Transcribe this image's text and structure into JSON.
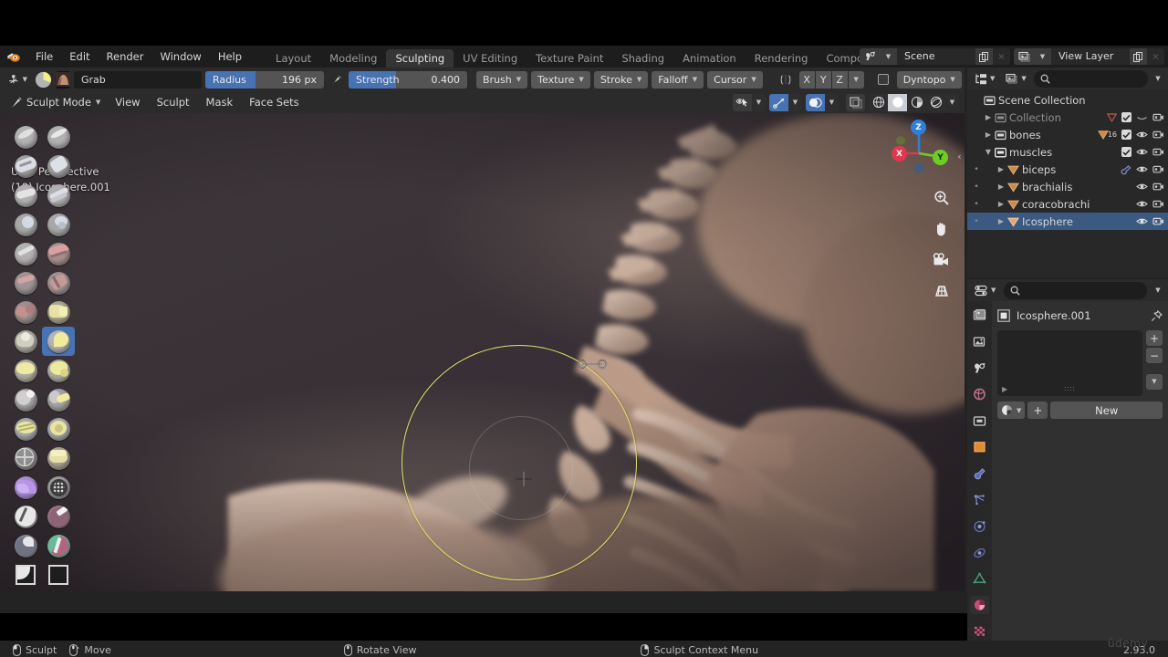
{
  "app": {
    "name": "Blender",
    "version": "2.93.0",
    "watermark": "ûdemy"
  },
  "topbar": {
    "logo_icon": "blender-logo-icon",
    "menus": [
      "File",
      "Edit",
      "Render",
      "Window",
      "Help"
    ],
    "workspaces": [
      {
        "label": "Layout",
        "active": false
      },
      {
        "label": "Modeling",
        "active": false
      },
      {
        "label": "Sculpting",
        "active": true
      },
      {
        "label": "UV Editing",
        "active": false
      },
      {
        "label": "Texture Paint",
        "active": false
      },
      {
        "label": "Shading",
        "active": false
      },
      {
        "label": "Animation",
        "active": false
      },
      {
        "label": "Rendering",
        "active": false
      },
      {
        "label": "Compos",
        "active": false
      }
    ],
    "scene": {
      "icon": "scene-icon",
      "name": "Scene",
      "new_icon": "duplicate-icon",
      "close_icon": "×"
    },
    "view_layer": {
      "icon": "view-layer-icon",
      "name": "View Layer",
      "new_icon": "duplicate-icon",
      "close_icon": "×"
    }
  },
  "tool_settings": {
    "tool_selector_icon": "sculpt-tool-icon",
    "brush_preview_icon": "brush-falloff-icon",
    "brush_texture_icon": "brush-thumbnail-icon",
    "brush_name": "Grab",
    "radius": {
      "label": "Radius",
      "value": "196 px",
      "fill_percent": 42
    },
    "radius_pressure_icon": "pressure-icon",
    "strength": {
      "label": "Strength",
      "value": "0.400",
      "fill_percent": 40
    },
    "popovers": [
      "Brush",
      "Texture",
      "Stroke",
      "Falloff",
      "Cursor"
    ],
    "symmetry_icon": "symmetry-icon",
    "symmetry_axes": [
      "X",
      "Y",
      "Z"
    ],
    "dyntopo_checkbox": false,
    "dyntopo_label": "Dyntopo"
  },
  "viewport_header": {
    "mode": "Sculpt Mode",
    "mode_icon": "sculpt-mode-icon",
    "menus": [
      "View",
      "Sculpt",
      "Mask",
      "Face Sets"
    ],
    "overlay_toggles": [
      {
        "name": "show-gizmo-icon",
        "on": false
      },
      {
        "name": "gizmo-icon",
        "on": true
      },
      {
        "name": "overlays-icon",
        "on": true
      }
    ],
    "xray_icon": "x-ray-icon",
    "shading_modes": [
      {
        "name": "wireframe-shading",
        "on": false
      },
      {
        "name": "solid-shading",
        "on": true
      },
      {
        "name": "material-preview-shading",
        "on": false
      },
      {
        "name": "rendered-shading",
        "on": false
      }
    ]
  },
  "viewport": {
    "info_line1": "User Perspective",
    "info_line2": "(18) Icosphere.001",
    "brush_cursor_color": "#e5e06a",
    "gizmo": {
      "axes": [
        {
          "label": "Z",
          "color": "#2f7fd8"
        },
        {
          "label": "X",
          "color": "#e0384e"
        },
        {
          "label": "Y",
          "color": "#6fcc22"
        }
      ]
    },
    "side_buttons": [
      {
        "name": "zoom-icon"
      },
      {
        "name": "pan-hand-icon"
      },
      {
        "name": "camera-view-icon"
      },
      {
        "name": "toggle-perspective-icon"
      }
    ],
    "sidebar_expand_icon": "chevron-left-icon"
  },
  "brush_toolbar": {
    "tools": [
      {
        "name": "draw-brush",
        "selected": false
      },
      {
        "name": "draw-sharp-brush",
        "selected": false
      },
      {
        "name": "clay-brush",
        "selected": false
      },
      {
        "name": "clay-strips-brush",
        "selected": false
      },
      {
        "name": "clay-thumb-brush",
        "selected": false
      },
      {
        "name": "layer-brush",
        "selected": false
      },
      {
        "name": "inflate-brush",
        "selected": false
      },
      {
        "name": "blob-brush",
        "selected": false
      },
      {
        "name": "crease-brush",
        "selected": false
      },
      {
        "name": "smooth-brush",
        "selected": false
      },
      {
        "name": "flatten-brush",
        "selected": false
      },
      {
        "name": "fill-brush",
        "selected": false
      },
      {
        "name": "scrape-brush",
        "selected": false
      },
      {
        "name": "multiplane-scrape-brush",
        "selected": false
      },
      {
        "name": "pinch-brush",
        "selected": false
      },
      {
        "name": "grab-brush",
        "selected": true
      },
      {
        "name": "elastic-deform-brush",
        "selected": false
      },
      {
        "name": "snake-hook-brush",
        "selected": false
      },
      {
        "name": "thumb-brush",
        "selected": false
      },
      {
        "name": "pose-brush",
        "selected": false
      },
      {
        "name": "nudge-brush",
        "selected": false
      },
      {
        "name": "rotate-brush",
        "selected": false
      },
      {
        "name": "slide-relax-brush",
        "selected": false
      },
      {
        "name": "boundary-brush",
        "selected": false
      },
      {
        "name": "cloth-brush",
        "selected": false
      },
      {
        "name": "simplify-brush",
        "selected": false
      },
      {
        "name": "mask-brush",
        "selected": false
      },
      {
        "name": "draw-face-sets-brush",
        "selected": false
      },
      {
        "name": "multires-displacement-eraser",
        "selected": false
      },
      {
        "name": "paint-brush",
        "selected": false
      },
      {
        "name": "box-mask-tool",
        "selected": false
      },
      {
        "name": "box-hide-tool",
        "selected": false
      }
    ]
  },
  "outliner": {
    "display_mode_icon": "outliner-filter-icon",
    "filter_icon": "filter-icon",
    "search_icon": "search-icon",
    "search_placeholder": "",
    "rows": [
      {
        "indent": 0,
        "disclosure": "",
        "icon": "collection-icon",
        "label": "Scene Collection",
        "dim": false,
        "checkbox": false,
        "eye": false,
        "camera": false,
        "selected": false
      },
      {
        "indent": 1,
        "disclosure": "right",
        "icon": "collection-icon",
        "label": "Collection",
        "dim": true,
        "checkbox": true,
        "eye": "closed",
        "camera": true,
        "badge": "",
        "selected": false,
        "mesh_icon": true
      },
      {
        "indent": 1,
        "disclosure": "right",
        "icon": "collection-icon",
        "label": "bones",
        "dim": false,
        "checkbox": true,
        "eye": "open",
        "camera": true,
        "badge": "16",
        "selected": false,
        "mesh_icon": true
      },
      {
        "indent": 1,
        "disclosure": "down",
        "icon": "collection-icon",
        "label": "muscles",
        "dim": false,
        "checkbox": true,
        "eye": "open",
        "camera": true,
        "selected": false
      },
      {
        "indent": 2,
        "disclosure": "right",
        "icon": "mesh-data-icon",
        "label": "biceps",
        "dim": false,
        "eye": "open",
        "camera": true,
        "extra_icon": "modifier-icon",
        "selected": false
      },
      {
        "indent": 2,
        "disclosure": "right",
        "icon": "mesh-data-icon",
        "label": "brachialis",
        "dim": false,
        "eye": "open",
        "camera": true,
        "selected": false
      },
      {
        "indent": 2,
        "disclosure": "right",
        "icon": "mesh-data-icon",
        "label": "coracobrachi",
        "dim": false,
        "eye": "open",
        "camera": true,
        "selected": false
      },
      {
        "indent": 2,
        "disclosure": "right",
        "icon": "mesh-data-icon",
        "label": "Icosphere",
        "dim": false,
        "eye": "open",
        "camera": true,
        "selected": true
      }
    ]
  },
  "properties": {
    "editor_type_icon": "properties-editor-icon",
    "object_icon": "object-icon",
    "search_icon": "search-icon",
    "search_placeholder": "",
    "options_chevron": "chevron-down-icon",
    "tabs": [
      {
        "name": "render-properties-tab",
        "active": false
      },
      {
        "name": "output-properties-tab",
        "active": false
      },
      {
        "name": "view-layer-properties-tab",
        "active": false
      },
      {
        "name": "scene-properties-tab",
        "active": false
      },
      {
        "name": "world-properties-tab",
        "active": false
      },
      {
        "name": "collection-properties-tab",
        "active": false
      },
      {
        "name": "object-properties-tab",
        "active": false
      },
      {
        "name": "modifier-properties-tab",
        "active": false
      },
      {
        "name": "particle-properties-tab",
        "active": false
      },
      {
        "name": "physics-properties-tab",
        "active": false
      },
      {
        "name": "constraint-properties-tab",
        "active": false
      },
      {
        "name": "object-data-properties-tab",
        "active": false
      },
      {
        "name": "material-properties-tab",
        "active": true
      },
      {
        "name": "texture-properties-tab",
        "active": false
      }
    ],
    "breadcrumb": {
      "icon": "material-icon",
      "label": "Icosphere.001",
      "pin_icon": "pin-icon"
    },
    "slot_list": {
      "expand_icon": "triangle-right-icon",
      "grip_icon": "grip-dots"
    },
    "slot_buttons": [
      {
        "name": "add-material-slot-button",
        "label": "+"
      },
      {
        "name": "remove-material-slot-button",
        "label": "−"
      },
      {
        "name": "material-specials-button",
        "label": "⌄"
      }
    ],
    "new_row": {
      "browse_icon": "browse-material-icon",
      "plus_label": "+",
      "new_label": "New"
    }
  },
  "statusbar": {
    "items": [
      {
        "icon": "mouse-left-icon",
        "label": "Sculpt"
      },
      {
        "icon": "mouse-move-icon",
        "label": "Move"
      },
      {
        "icon": "mouse-middle-icon",
        "label": "Rotate View"
      },
      {
        "icon": "mouse-right-icon",
        "label": "Sculpt Context Menu"
      }
    ],
    "version": "2.93.0"
  }
}
